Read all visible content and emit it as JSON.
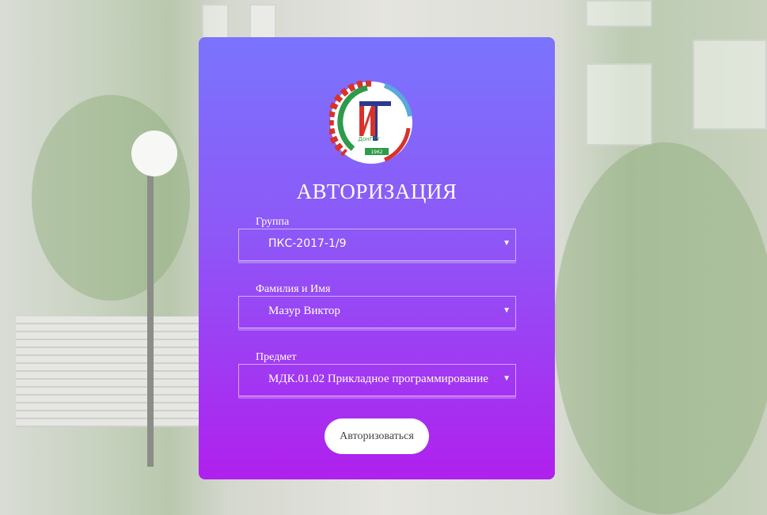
{
  "logo": {
    "text_main": "ИТ",
    "text_sub": "ДонГТУ",
    "year": "1962",
    "ring_text": "Индустриальный техникум ДонГТУ"
  },
  "title": "АВТОРИЗАЦИЯ",
  "fields": [
    {
      "label": "Группа",
      "value": "ПКС-2017-1/9"
    },
    {
      "label": "Фамилия и Имя",
      "value": "Мазур Виктор"
    },
    {
      "label": "Предмет",
      "value": "МДК.01.02 Прикладное программирование"
    }
  ],
  "submit_label": "Авторизоваться",
  "colors": {
    "gradient_top": "#7a74fd",
    "gradient_bottom": "#b020ee"
  }
}
